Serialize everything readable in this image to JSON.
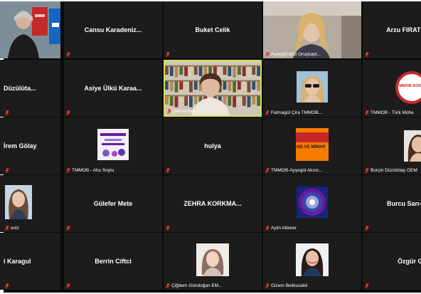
{
  "participants": [
    {
      "id": "t00",
      "name": "",
      "video": "presenter-photo"
    },
    {
      "id": "t01",
      "name": "Cansu Karadeniz..."
    },
    {
      "id": "t02",
      "name": "Buket Celik"
    },
    {
      "id": "t03",
      "name": "Ayşegül Ibici Oruçkapt...",
      "video": "blonde-woman"
    },
    {
      "id": "t04",
      "name": "Arzu FIRAT E"
    },
    {
      "id": "t10",
      "name": "Düzülüta..."
    },
    {
      "id": "t11",
      "name": "Asiye Ülkü Karaa..."
    },
    {
      "id": "t12",
      "name": "yakinerturk",
      "video": "speaker-bookshelf"
    },
    {
      "id": "t13",
      "name": "Fatmagül Çira TMMOB...",
      "video": "sunglasses-avatar"
    },
    {
      "id": "t14",
      "name": "TMMOB - Türk Mühe",
      "video": "tmmob-logo",
      "logo_text": "TMMOB DOKUNM"
    },
    {
      "id": "t20",
      "name": "İrem Gölay"
    },
    {
      "id": "t21",
      "name": "TMMOB - Ahu Soylu",
      "video": "purple-poster"
    },
    {
      "id": "t22",
      "name": "hulya"
    },
    {
      "id": "t23",
      "name": "TMMOB-Ayşegül Akınc...",
      "video": "orange-logo",
      "logo_text": "MS VE MİMAR"
    },
    {
      "id": "t24",
      "name": "Burçin Düzülütaş GEM",
      "video": "woman-portrait"
    },
    {
      "id": "t30",
      "name": "eniz",
      "video": "long-hair-woman"
    },
    {
      "id": "t31",
      "name": "Gülefer Mete"
    },
    {
      "id": "t32",
      "name": "ZEHRA KORKMA..."
    },
    {
      "id": "t33",
      "name": "Aylin Altaner",
      "video": "round-seal"
    },
    {
      "id": "t34",
      "name": "Burcu Sarı-M"
    },
    {
      "id": "t40",
      "name": "i Karagul"
    },
    {
      "id": "t41",
      "name": "Berrin Ciftci"
    },
    {
      "id": "t42",
      "name": "Çiğdem Gündoğan EM...",
      "video": "woman-drawing"
    },
    {
      "id": "t43",
      "name": "Gizem Belikusakli",
      "video": "smiling-woman"
    },
    {
      "id": "t44",
      "name": "Özgür Gö"
    }
  ],
  "colors": {
    "tile": "#1c1c1c",
    "muted_icon": "#e53935",
    "speaking_border": "#d4e157"
  }
}
